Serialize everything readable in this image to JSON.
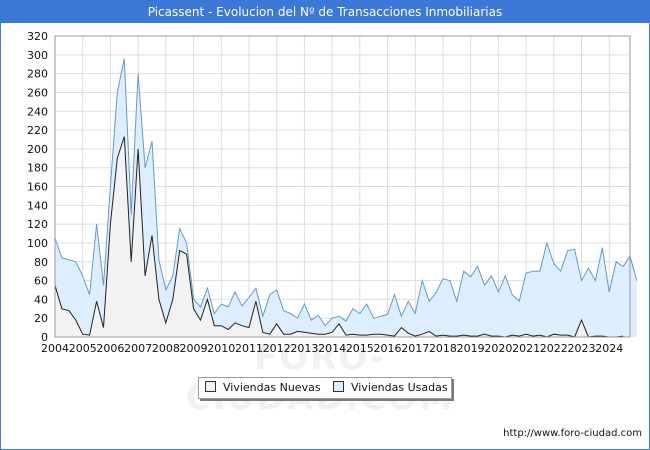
{
  "window": {
    "title": "Picassent - Evolucion del Nº de Transacciones Inmobiliarias"
  },
  "footer": {
    "url": "http://www.foro-ciudad.com"
  },
  "watermark": {
    "text": "FORO-CIUDAD.COM"
  },
  "colors": {
    "accent": "#3b78d8",
    "usadas_fill": "#ddeeff",
    "usadas_line": "#6699cc",
    "nuevas_fill": "#f2f2f2",
    "nuevas_line": "#222222",
    "grid": "#dddddd"
  },
  "chart_data": {
    "type": "area",
    "title": "Picassent - Evolucion del Nº de Transacciones Inmobiliarias",
    "xlabel": "",
    "ylabel": "",
    "ylim": [
      0,
      320
    ],
    "yticks": [
      0,
      20,
      40,
      60,
      80,
      100,
      120,
      140,
      160,
      180,
      200,
      220,
      240,
      260,
      280,
      300,
      320
    ],
    "xlim": [
      2004,
      2024.75
    ],
    "xticks": [
      "2004",
      "2005",
      "2006",
      "2007",
      "2008",
      "2009",
      "2010",
      "2011",
      "2012",
      "2013",
      "2014",
      "2015",
      "2016",
      "2017",
      "2018",
      "2019",
      "2020",
      "2021",
      "2022",
      "2023",
      "2024"
    ],
    "x_step": "quarter",
    "x_start": "2004-Q1",
    "grid": true,
    "legend_position": "bottom",
    "series": [
      {
        "name": "Viviendas Nuevas",
        "values": [
          55,
          30,
          28,
          18,
          3,
          2,
          38,
          10,
          120,
          190,
          213,
          80,
          200,
          65,
          108,
          40,
          15,
          40,
          92,
          88,
          30,
          18,
          40,
          12,
          12,
          8,
          15,
          12,
          10,
          38,
          5,
          3,
          14,
          3,
          3,
          6,
          5,
          4,
          3,
          3,
          5,
          14,
          2,
          3,
          2,
          2,
          3,
          3,
          2,
          1,
          10,
          4,
          1,
          3,
          6,
          1,
          2,
          1,
          1,
          2,
          1,
          1,
          3,
          1,
          1,
          0,
          2,
          1,
          3,
          1,
          2,
          0,
          3,
          2,
          2,
          0,
          18,
          0,
          1,
          1,
          0,
          0,
          1
        ]
      },
      {
        "name": "Viviendas Usadas",
        "values": [
          105,
          84,
          82,
          80,
          65,
          45,
          120,
          55,
          160,
          260,
          296,
          130,
          280,
          180,
          208,
          82,
          50,
          65,
          115,
          100,
          40,
          32,
          52,
          25,
          35,
          32,
          48,
          33,
          42,
          52,
          22,
          45,
          50,
          28,
          25,
          20,
          35,
          18,
          23,
          12,
          20,
          22,
          17,
          30,
          25,
          35,
          20,
          22,
          24,
          45,
          22,
          38,
          25,
          60,
          38,
          47,
          62,
          60,
          38,
          70,
          64,
          75,
          55,
          65,
          48,
          65,
          45,
          38,
          68,
          70,
          70,
          100,
          78,
          70,
          92,
          93,
          60,
          73,
          60,
          95,
          48,
          80,
          75,
          86,
          60
        ]
      }
    ]
  }
}
